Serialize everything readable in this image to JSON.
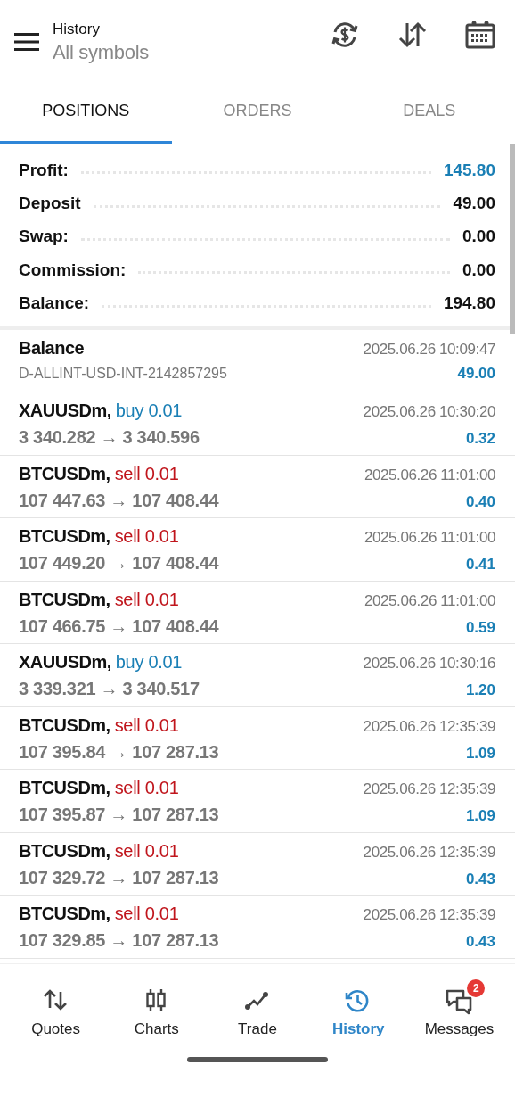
{
  "header": {
    "title": "History",
    "subtitle": "All symbols"
  },
  "tabs": [
    {
      "label": "POSITIONS",
      "selected": true
    },
    {
      "label": "ORDERS",
      "selected": false
    },
    {
      "label": "DEALS",
      "selected": false
    }
  ],
  "summary": [
    {
      "label": "Profit:",
      "value": "145.80",
      "highlighted": true
    },
    {
      "label": "Deposit",
      "value": "49.00",
      "highlighted": false
    },
    {
      "label": "Swap:",
      "value": "0.00",
      "highlighted": false
    },
    {
      "label": "Commission:",
      "value": "0.00",
      "highlighted": false
    },
    {
      "label": "Balance:",
      "value": "194.80",
      "highlighted": false
    }
  ],
  "entries": [
    {
      "kind": "balance",
      "symbol": "Balance",
      "details": "D-ALLINT-USD-INT-2142857295",
      "time": "2025.06.26 10:09:47",
      "amount": "49.00"
    },
    {
      "kind": "trade",
      "symbol": "XAUUSDm,",
      "volume": "buy 0.01",
      "color": "#1a7fb5",
      "prices": "3 340.282 → 3 340.596",
      "time": "2025.06.26 10:30:20",
      "amount": "0.32"
    },
    {
      "kind": "trade",
      "symbol": "BTCUSDm,",
      "volume": "sell 0.01",
      "color": "#c0151c",
      "prices": "107 447.63 → 107 408.44",
      "time": "2025.06.26 11:01:00",
      "amount": "0.40"
    },
    {
      "kind": "trade",
      "symbol": "BTCUSDm,",
      "volume": "sell 0.01",
      "color": "#c0151c",
      "prices": "107 449.20 → 107 408.44",
      "time": "2025.06.26 11:01:00",
      "amount": "0.41"
    },
    {
      "kind": "trade",
      "symbol": "BTCUSDm,",
      "volume": "sell 0.01",
      "color": "#c0151c",
      "prices": "107 466.75 → 107 408.44",
      "time": "2025.06.26 11:01:00",
      "amount": "0.59"
    },
    {
      "kind": "trade",
      "symbol": "XAUUSDm,",
      "volume": "buy 0.01",
      "color": "#1a7fb5",
      "prices": "3 339.321 → 3 340.517",
      "time": "2025.06.26 10:30:16",
      "amount": "1.20"
    },
    {
      "kind": "trade",
      "symbol": "BTCUSDm,",
      "volume": "sell 0.01",
      "color": "#c0151c",
      "prices": "107 395.84 → 107 287.13",
      "time": "2025.06.26 12:35:39",
      "amount": "1.09"
    },
    {
      "kind": "trade",
      "symbol": "BTCUSDm,",
      "volume": "sell 0.01",
      "color": "#c0151c",
      "prices": "107 395.87 → 107 287.13",
      "time": "2025.06.26 12:35:39",
      "amount": "1.09"
    },
    {
      "kind": "trade",
      "symbol": "BTCUSDm,",
      "volume": "sell 0.01",
      "color": "#c0151c",
      "prices": "107 329.72 → 107 287.13",
      "time": "2025.06.26 12:35:39",
      "amount": "0.43"
    },
    {
      "kind": "trade",
      "symbol": "BTCUSDm,",
      "volume": "sell 0.01",
      "color": "#c0151c",
      "prices": "107 329.85 → 107 287.13",
      "time": "2025.06.26 12:35:39",
      "amount": "0.43"
    }
  ],
  "nav": [
    {
      "kind": "quotes",
      "label": "Quotes",
      "selected": false
    },
    {
      "kind": "charts",
      "label": "Charts",
      "selected": false
    },
    {
      "kind": "trade",
      "label": "Trade",
      "selected": false
    },
    {
      "kind": "history",
      "label": "History",
      "selected": true
    },
    {
      "kind": "messages",
      "label": "Messages",
      "selected": false,
      "badge": "2"
    }
  ]
}
